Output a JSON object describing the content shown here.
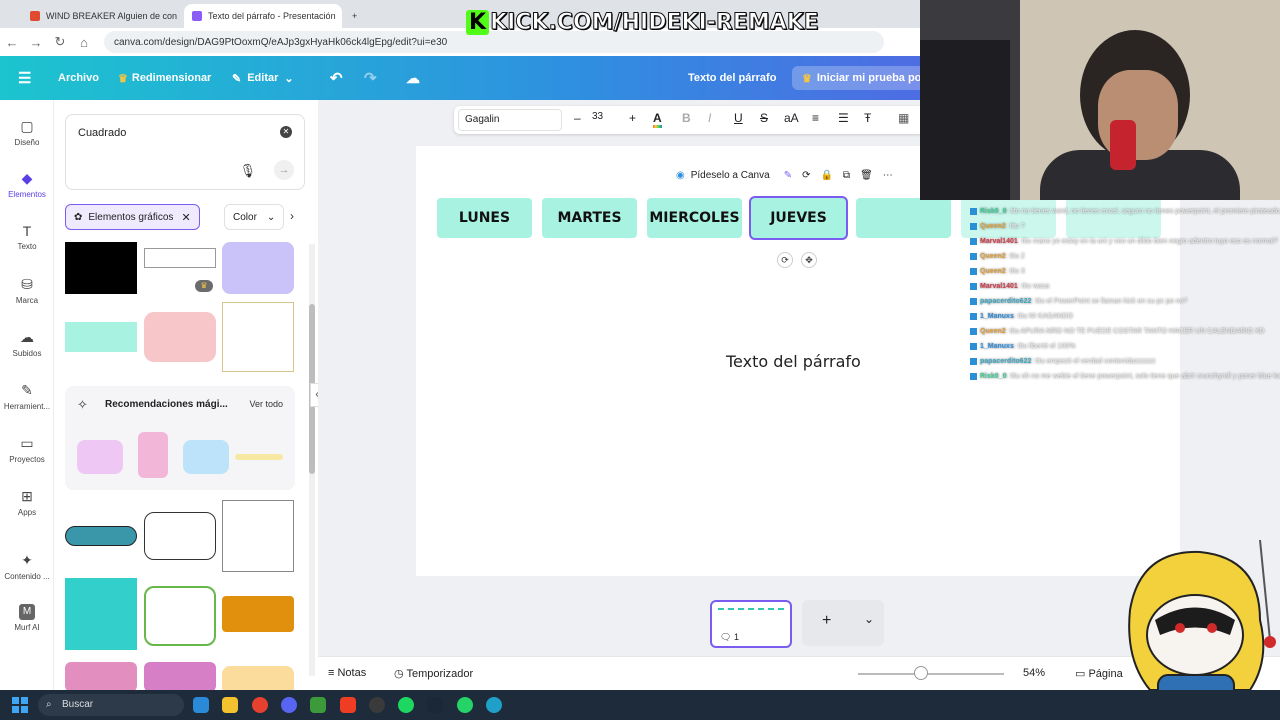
{
  "browser": {
    "tabs": [
      {
        "title": "WIND BREAKER Alguien de con"
      },
      {
        "title": "Texto del párrafo - Presentación"
      }
    ],
    "url": "canva.com/design/DAG9PtOoxmQ/eAJp3gxHyaHk06ck4lgEpg/edit?ui=e30"
  },
  "overlay": {
    "kick_banner": "KICK.COM/HIDEKI-REMAKE"
  },
  "canva_header": {
    "file_label": "Archivo",
    "resize_label": "Redimensionar",
    "edit_label": "Editar",
    "doc_title": "Texto del párrafo",
    "trial_label": "Iniciar mi prueba por"
  },
  "rail": [
    {
      "label": "Diseño",
      "icon": "layout-icon"
    },
    {
      "label": "Elementos",
      "icon": "elements-icon"
    },
    {
      "label": "Texto",
      "icon": "text-icon"
    },
    {
      "label": "Marca",
      "icon": "brand-icon"
    },
    {
      "label": "Subidos",
      "icon": "upload-icon"
    },
    {
      "label": "Herramient...",
      "icon": "tools-icon"
    },
    {
      "label": "Proyectos",
      "icon": "folder-icon"
    },
    {
      "label": "Apps",
      "icon": "apps-icon"
    },
    {
      "label": "Contenido ...",
      "icon": "content-icon"
    },
    {
      "label": "Murf AI",
      "icon": "murf-icon"
    }
  ],
  "panel": {
    "search_value": "Cuadrado",
    "filter_chip": "Elementos gráficos",
    "color_filter": "Color",
    "reco_title": "Recomendaciones mági...",
    "reco_link": "Ver todo"
  },
  "toolbar": {
    "font": "Gagalin",
    "size": "33"
  },
  "canvas": {
    "ai_prompt": "Pídeselo a Canva",
    "days": [
      "LUNES",
      "MARTES",
      "MIERCOLES",
      "JUEVES",
      "",
      "",
      ""
    ],
    "paragraph": "Texto del párrafo"
  },
  "pages": {
    "count": "1"
  },
  "bottom": {
    "notes": "Notas",
    "timer": "Temporizador",
    "zoom": "54%",
    "page_label": "Página"
  },
  "taskbar": {
    "search": "Buscar"
  },
  "chat": [
    {
      "user": "Risk0_0",
      "text": ": tito no tienes word, no tienes excel, seguro no tienes powerpoint, el premiere pirateado, ni el canva pro tienes",
      "color": "#3fd19b"
    },
    {
      "user": "Queen2",
      "text": ": titu ?",
      "color": "#e3a13b"
    },
    {
      "user": "Marval1401",
      "text": ": titu mano yo estoy en la uni y veo un dildo bien negro adentro tuyo eso es normal?",
      "color": "#d13a4a"
    },
    {
      "user": "Queen2",
      "text": ": titu 2",
      "color": "#e3a13b"
    },
    {
      "user": "Queen2",
      "text": ": titu 3",
      "color": "#e3a13b"
    },
    {
      "user": "Marval1401",
      "text": ": titu wasa",
      "color": "#d13a4a"
    },
    {
      "user": "papacerdito622",
      "text": ": titu el PowerPoint se llaman kick en su pc po no?",
      "color": "#3fa9c6"
    },
    {
      "user": "1_Manuxs",
      "text": ": titu NI KAGANDO",
      "color": "#2f8fe0"
    },
    {
      "user": "Queen2",
      "text": ": titu APURA MRD NO TE PUEDE COSTAR TANTO HACER UN CALENDARIO XD",
      "color": "#e3a13b"
    },
    {
      "user": "1_Manuxs",
      "text": ": titu liberté el 100%",
      "color": "#2f8fe0"
    },
    {
      "user": "papacerdito622",
      "text": ": titu empezó el verdad contenidazzzzzz",
      "color": "#3fa9c6"
    },
    {
      "user": "Risk0_0",
      "text": ": titu oh no me webie el tiene powerpoint, solo tiene que abrir crunchyroll y poner blue lock",
      "color": "#3fd19b"
    }
  ],
  "colors": {
    "accent": "#7b5cf0",
    "day_box": "#a8f2e1"
  }
}
